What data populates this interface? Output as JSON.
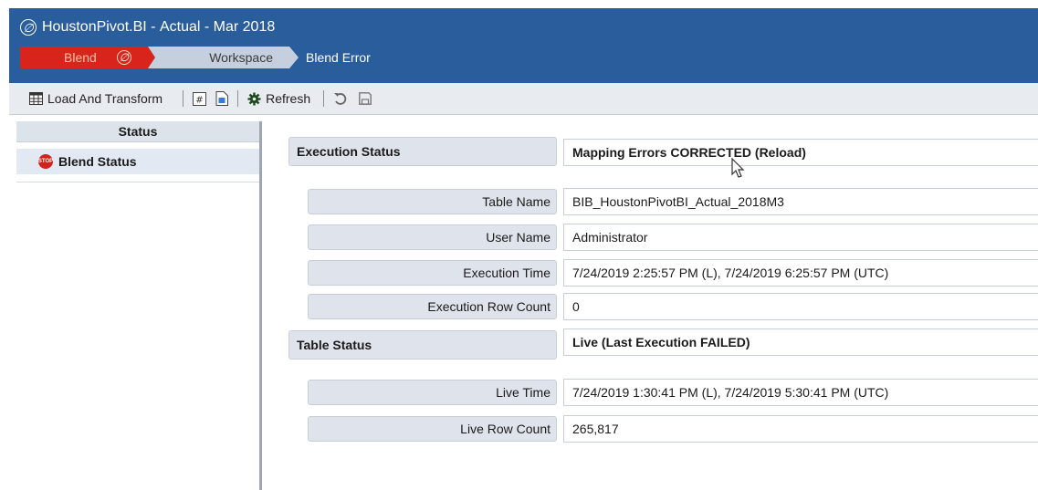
{
  "title": {
    "app": "HoustonPivot.BI",
    "separator1": " - ",
    "scenario": "Actual",
    "separator2": " - ",
    "period": "Mar 2018",
    "logo_glyph": "∅"
  },
  "breadcrumb": {
    "items": [
      "Blend",
      "Workspace",
      "Blend Error"
    ],
    "blend_color": "#d9241b"
  },
  "toolbar": {
    "load_transform": "Load And Transform",
    "refresh": "Refresh"
  },
  "left_panel": {
    "header": "Status",
    "items": [
      {
        "label": "Blend Status",
        "icon": "stop-icon"
      }
    ]
  },
  "details": {
    "execution_status": {
      "label": "Execution Status",
      "value": "Mapping Errors CORRECTED (Reload)"
    },
    "table_name": {
      "label": "Table Name",
      "value": "BIB_HoustonPivotBI_Actual_2018M3"
    },
    "user_name": {
      "label": "User Name",
      "value": "Administrator"
    },
    "execution_time": {
      "label": "Execution Time",
      "value": "7/24/2019 2:25:57 PM (L), 7/24/2019 6:25:57 PM (UTC)"
    },
    "execution_row_count": {
      "label": "Execution Row Count",
      "value": "0"
    },
    "table_status": {
      "label": "Table Status",
      "value": "Live (Last Execution FAILED)"
    },
    "live_time": {
      "label": "Live Time",
      "value": "7/24/2019 1:30:41 PM (L), 7/24/2019 5:30:41 PM (UTC)"
    },
    "live_row_count": {
      "label": "Live Row Count",
      "value": "265,817"
    }
  }
}
